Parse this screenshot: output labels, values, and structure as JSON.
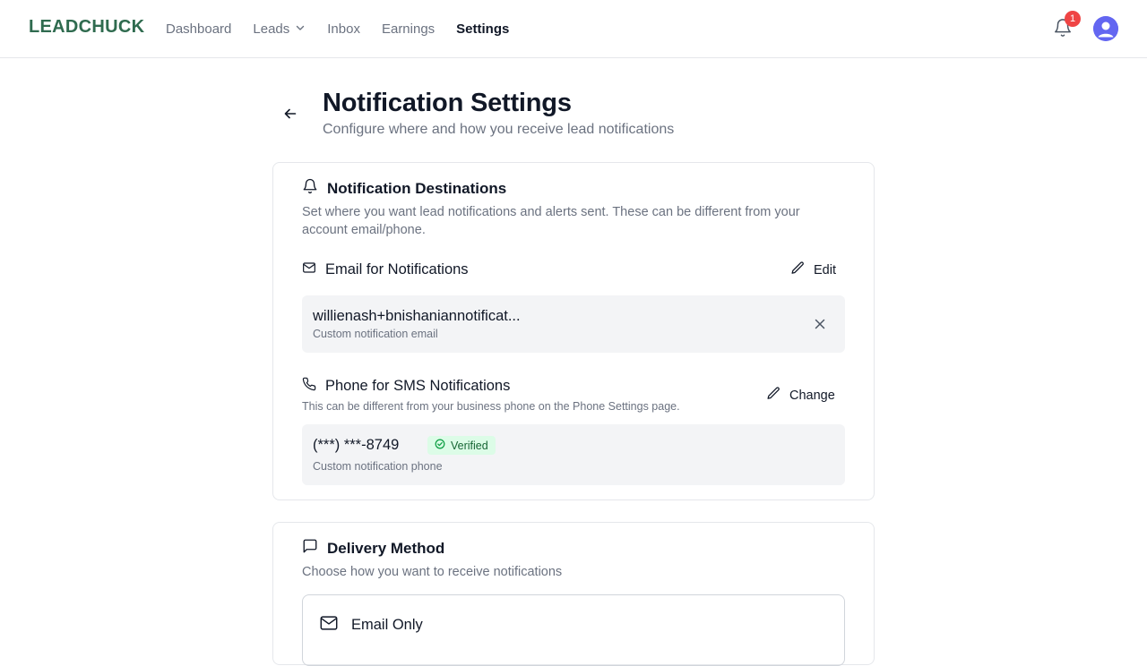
{
  "header": {
    "logo": "LEADCHUCK",
    "nav": [
      {
        "label": "Dashboard"
      },
      {
        "label": "Leads"
      },
      {
        "label": "Inbox"
      },
      {
        "label": "Earnings"
      },
      {
        "label": "Settings"
      }
    ],
    "notification_count": "1"
  },
  "page": {
    "title": "Notification Settings",
    "subtitle": "Configure where and how you receive lead notifications"
  },
  "destinations": {
    "title": "Notification Destinations",
    "description": "Set where you want lead notifications and alerts sent. These can be different from your account email/phone.",
    "email": {
      "title": "Email for Notifications",
      "edit_label": "Edit",
      "value": "willienash+bnishaniannotificat...",
      "caption": "Custom notification email"
    },
    "phone": {
      "title": "Phone for SMS Notifications",
      "description": "This can be different from your business phone on the Phone Settings page.",
      "change_label": "Change",
      "value": "(***) ***-8749",
      "status": "Verified",
      "caption": "Custom notification phone"
    }
  },
  "delivery": {
    "title": "Delivery Method",
    "description": "Choose how you want to receive notifications",
    "options": [
      {
        "label": "Email Only"
      }
    ]
  },
  "colors": {
    "brand": "#2f6b4f",
    "badge": "#ef4444",
    "avatar": "#6366f1",
    "verified_bg": "#dcfce7"
  }
}
